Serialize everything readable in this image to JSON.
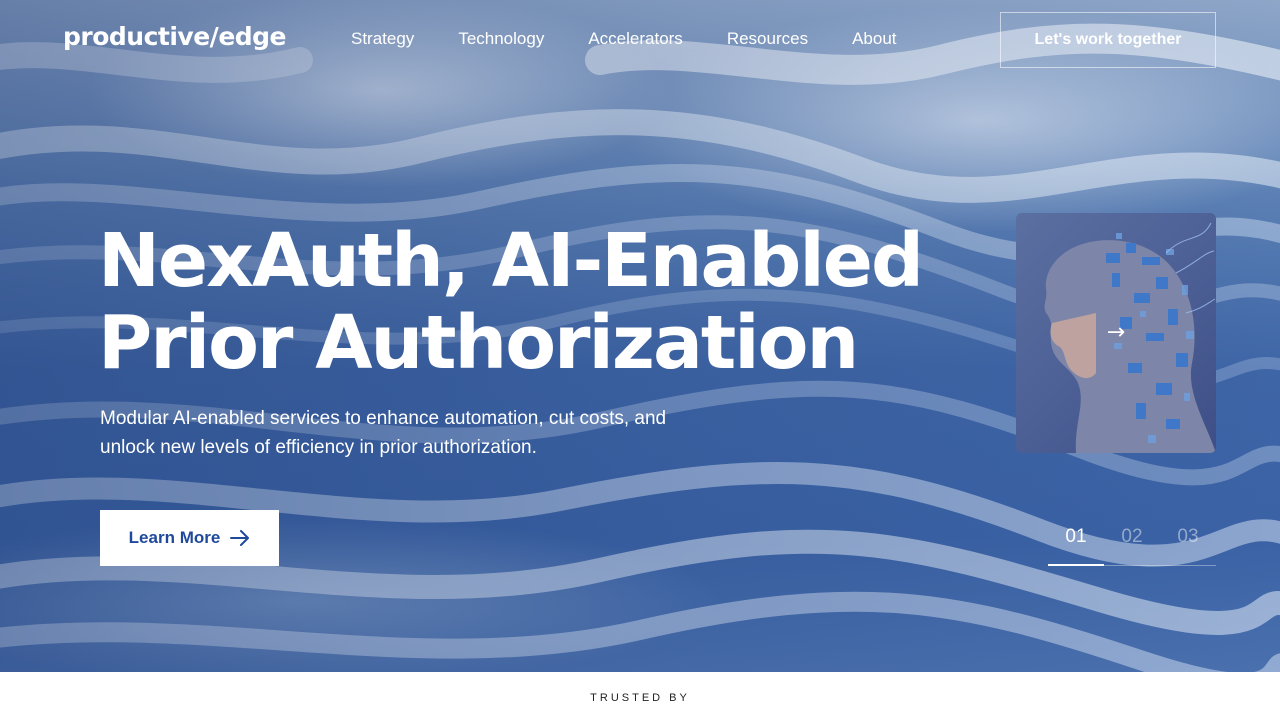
{
  "brand": {
    "logo_text": "productive/edge"
  },
  "nav": {
    "items": [
      {
        "label": "Strategy"
      },
      {
        "label": "Technology"
      },
      {
        "label": "Accelerators"
      },
      {
        "label": "Resources"
      },
      {
        "label": "About"
      }
    ],
    "cta_label": "Let's work together"
  },
  "hero": {
    "title_line1": "NexAuth, AI-Enabled",
    "title_line2": "Prior Authorization",
    "subtitle_line1": "Modular AI-enabled services to enhance automation, cut costs, and",
    "subtitle_line2": "unlock new levels of efficiency in prior authorization.",
    "button_label": "Learn More",
    "button_icon": "arrow-right-icon",
    "card_icon": "arrow-right-icon"
  },
  "pager": {
    "slides": [
      "01",
      "02",
      "03"
    ],
    "active_index": 0
  },
  "trusted": {
    "label": "TRUSTED BY"
  },
  "colors": {
    "hero_blue": "#3e65a6",
    "button_text": "#1f4a9c",
    "white": "#ffffff"
  }
}
